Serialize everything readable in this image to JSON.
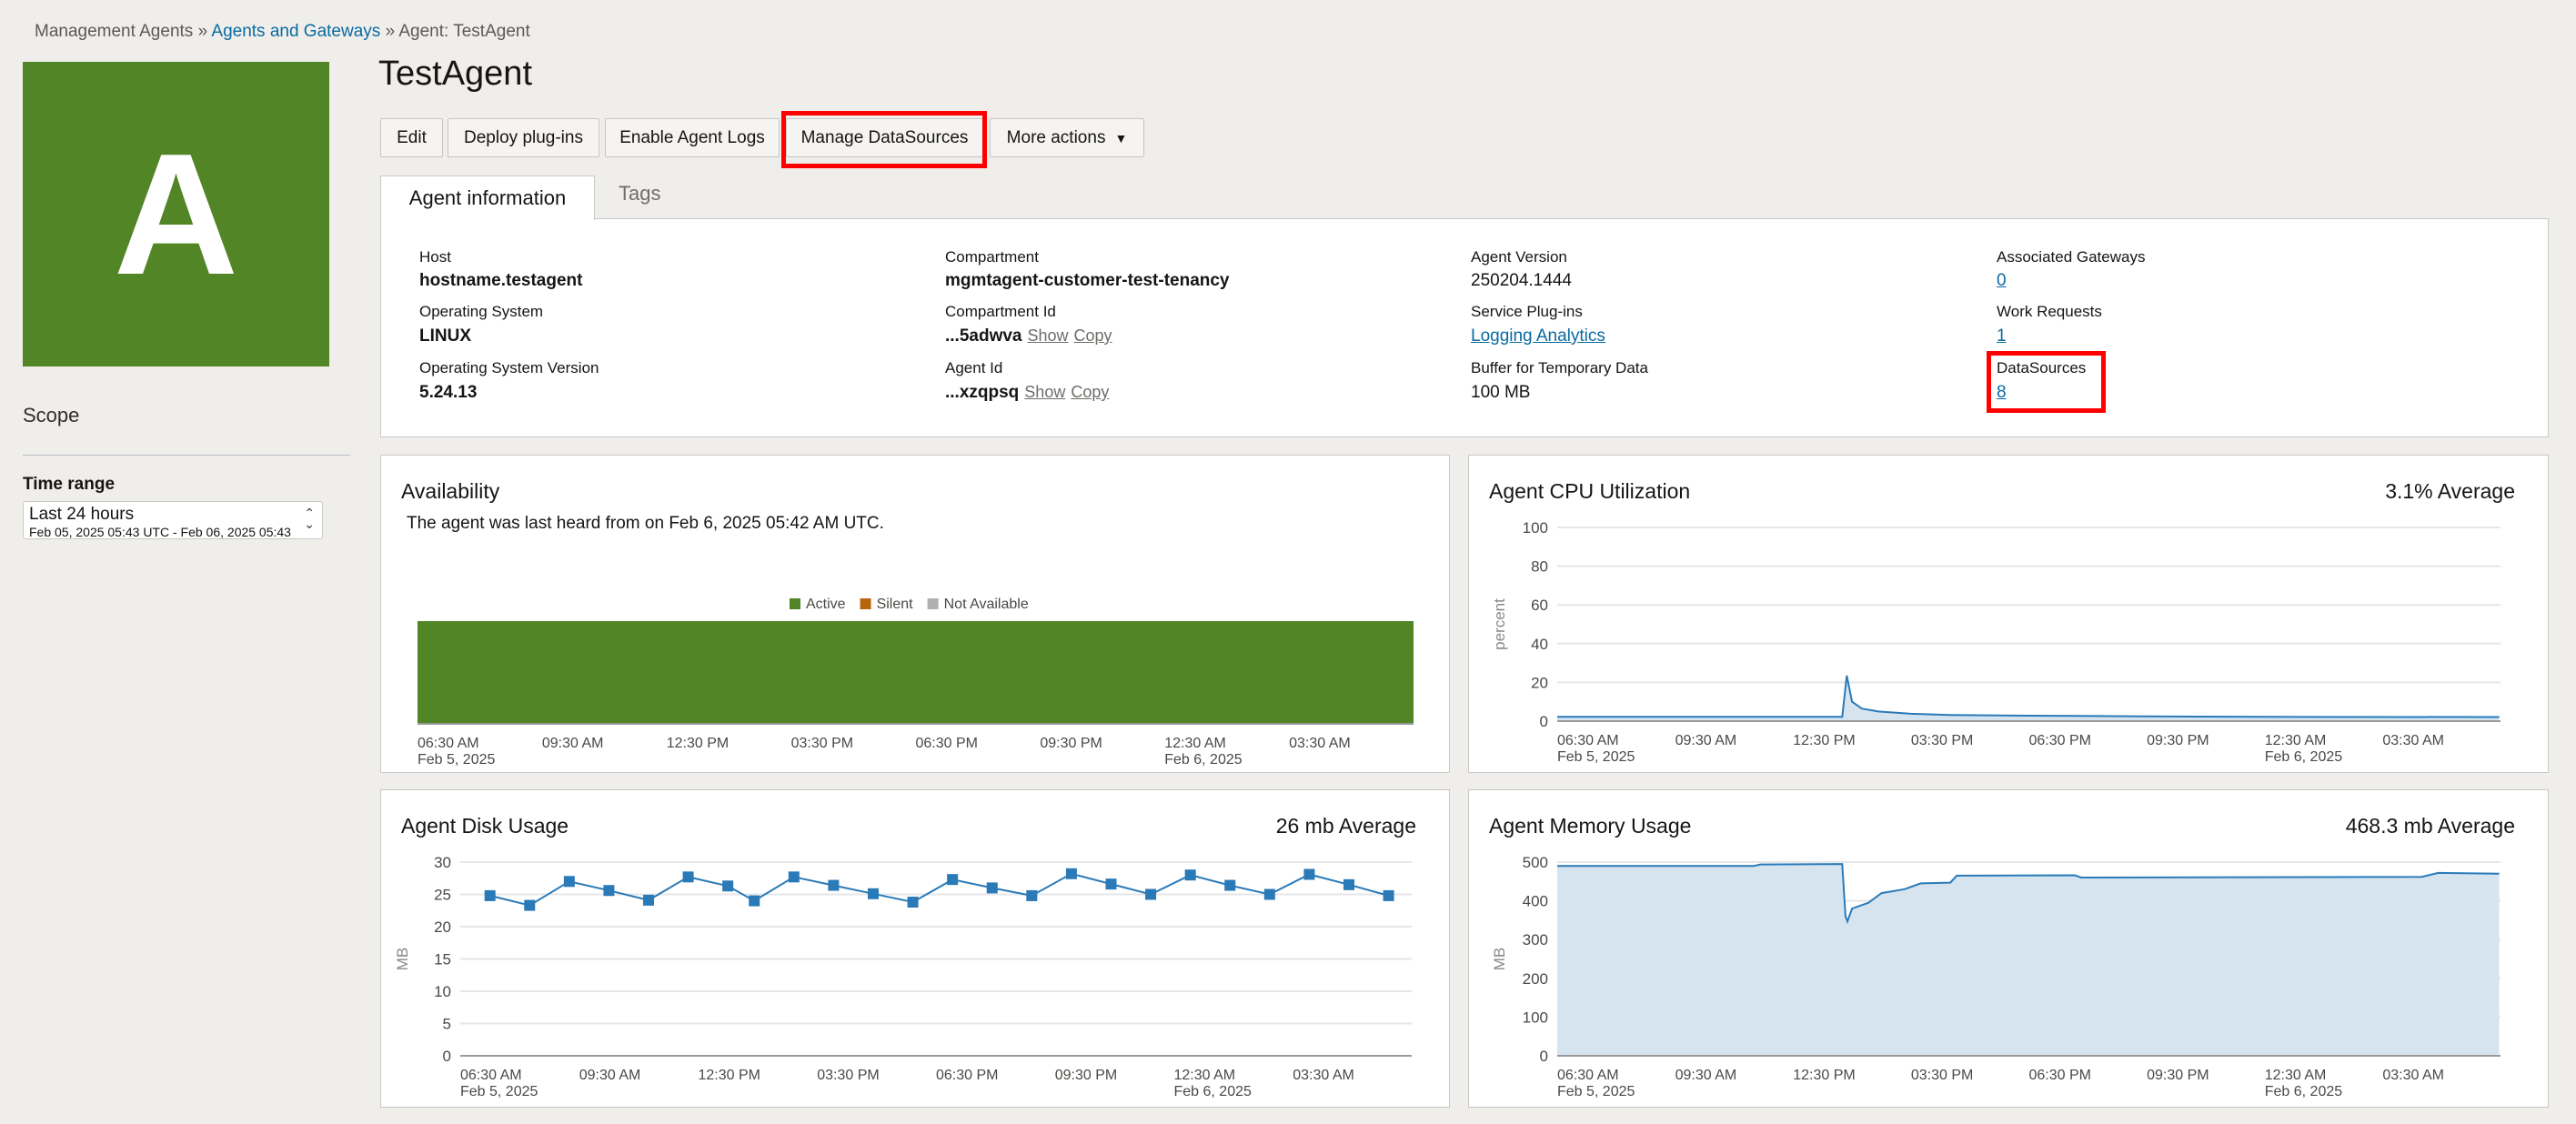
{
  "breadcrumb": {
    "items": [
      "Management Agents",
      "Agents and Gateways",
      "Agent: TestAgent"
    ],
    "separator": "»"
  },
  "avatar": {
    "letter": "A",
    "color": "#528526"
  },
  "sidebar": {
    "scope_label": "Scope",
    "time_range": {
      "label": "Time range",
      "value": "Last 24 hours",
      "detail": "Feb 05, 2025 05:43 UTC - Feb 06, 2025 05:43"
    }
  },
  "header": {
    "title": "TestAgent"
  },
  "toolbar": {
    "edit": "Edit",
    "deploy_plugins": "Deploy plug-ins",
    "enable_logs": "Enable Agent Logs",
    "manage_datasources": "Manage DataSources",
    "more_actions": "More actions",
    "more_actions_caret": "▼"
  },
  "tabs": [
    {
      "label": "Agent information",
      "active": true
    },
    {
      "label": "Tags",
      "active": false
    }
  ],
  "info": {
    "host": {
      "label": "Host",
      "value": "hostname.testagent"
    },
    "os": {
      "label": "Operating System",
      "value": "LINUX"
    },
    "os_version": {
      "label": "Operating System Version",
      "value": "5.24.13"
    },
    "compartment": {
      "label": "Compartment",
      "value": "mgmtagent-customer-test-tenancy"
    },
    "compartment_id": {
      "label": "Compartment Id",
      "value": "...5adwva",
      "show": "Show",
      "copy": "Copy"
    },
    "agent_id": {
      "label": "Agent Id",
      "value": "...xzqpsq",
      "show": "Show",
      "copy": "Copy"
    },
    "agent_version": {
      "label": "Agent Version",
      "value": "250204.1444"
    },
    "service_plugins": {
      "label": "Service Plug-ins",
      "value": "Logging Analytics"
    },
    "buffer": {
      "label": "Buffer for Temporary Data",
      "value": "100 MB"
    },
    "associated_gateways": {
      "label": "Associated Gateways",
      "value": "0"
    },
    "work_requests": {
      "label": "Work Requests",
      "value": "1"
    },
    "datasources": {
      "label": "DataSources",
      "value": "8"
    }
  },
  "highlight_color": "#ff0000",
  "panels": {
    "availability": {
      "title": "Availability",
      "message": "The agent was last heard from on Feb 6, 2025 05:42 AM UTC."
    },
    "cpu": {
      "title": "Agent CPU Utilization",
      "average": "3.1% Average"
    },
    "disk": {
      "title": "Agent Disk Usage",
      "average": "26 mb Average"
    },
    "memory": {
      "title": "Agent Memory Usage",
      "average": "468.3 mb Average"
    }
  },
  "chart_data": [
    {
      "id": "availability",
      "type": "bar",
      "legend": [
        {
          "name": "Active",
          "color": "#528526"
        },
        {
          "name": "Silent",
          "color": "#b8640c"
        },
        {
          "name": "Not Available",
          "color": "#b0b0b0"
        }
      ],
      "legend_position": "top",
      "segments": [
        {
          "status": "Active",
          "start": "2025-02-05T06:30",
          "end": "2025-02-06T06:30"
        }
      ],
      "xlim": [
        "2025-02-05T06:30",
        "2025-02-06T06:30"
      ],
      "x_ticks": [
        {
          "time": "2025-02-05T06:30",
          "label": "06:30 AM",
          "sublabel": "Feb 5, 2025"
        },
        {
          "time": "2025-02-05T09:30",
          "label": "09:30 AM",
          "sublabel": ""
        },
        {
          "time": "2025-02-05T12:30",
          "label": "12:30 PM",
          "sublabel": ""
        },
        {
          "time": "2025-02-05T15:30",
          "label": "03:30 PM",
          "sublabel": ""
        },
        {
          "time": "2025-02-05T18:30",
          "label": "06:30 PM",
          "sublabel": ""
        },
        {
          "time": "2025-02-05T21:30",
          "label": "09:30 PM",
          "sublabel": ""
        },
        {
          "time": "2025-02-06T00:30",
          "label": "12:30 AM",
          "sublabel": "Feb 6, 2025"
        },
        {
          "time": "2025-02-06T03:30",
          "label": "03:30 AM",
          "sublabel": ""
        }
      ]
    },
    {
      "id": "cpu",
      "type": "area",
      "ylabel": "percent",
      "ylim": [
        0,
        100
      ],
      "y_ticks": [
        0,
        20,
        40,
        60,
        80,
        100
      ],
      "grid": true,
      "color": "#2a7ab8",
      "xlim": [
        "2025-02-05T06:30",
        "2025-02-06T06:30"
      ],
      "x_ticks": [
        {
          "time": "2025-02-05T06:30",
          "label": "06:30 AM",
          "sublabel": "Feb 5, 2025"
        },
        {
          "time": "2025-02-05T09:30",
          "label": "09:30 AM",
          "sublabel": ""
        },
        {
          "time": "2025-02-05T12:30",
          "label": "12:30 PM",
          "sublabel": ""
        },
        {
          "time": "2025-02-05T15:30",
          "label": "03:30 PM",
          "sublabel": ""
        },
        {
          "time": "2025-02-05T18:30",
          "label": "06:30 PM",
          "sublabel": ""
        },
        {
          "time": "2025-02-05T21:30",
          "label": "09:30 PM",
          "sublabel": ""
        },
        {
          "time": "2025-02-06T00:30",
          "label": "12:30 AM",
          "sublabel": "Feb 6, 2025"
        },
        {
          "time": "2025-02-06T03:30",
          "label": "03:30 AM",
          "sublabel": ""
        }
      ],
      "points": [
        [
          "2025-02-05T06:30",
          2.2
        ],
        [
          "2025-02-05T13:45",
          2.2
        ],
        [
          "2025-02-05T13:52",
          23.5
        ],
        [
          "2025-02-05T14:00",
          10
        ],
        [
          "2025-02-05T14:15",
          6.5
        ],
        [
          "2025-02-05T14:40",
          5
        ],
        [
          "2025-02-05T15:30",
          3.8
        ],
        [
          "2025-02-05T16:30",
          3.2
        ],
        [
          "2025-02-05T18:30",
          2.8
        ],
        [
          "2025-02-05T21:30",
          2.5
        ],
        [
          "2025-02-06T00:30",
          2.2
        ],
        [
          "2025-02-06T06:28",
          2.1
        ]
      ]
    },
    {
      "id": "disk",
      "type": "line",
      "ylabel": "MB",
      "ylim": [
        0,
        30
      ],
      "y_ticks": [
        0,
        5,
        10,
        15,
        20,
        25,
        30
      ],
      "grid": true,
      "color": "#2a7ab8",
      "marker": "square",
      "xlim": [
        "2025-02-05T06:30",
        "2025-02-06T06:30"
      ],
      "x_ticks": [
        {
          "time": "2025-02-05T06:30",
          "label": "06:30 AM",
          "sublabel": "Feb 5, 2025"
        },
        {
          "time": "2025-02-05T09:30",
          "label": "09:30 AM",
          "sublabel": ""
        },
        {
          "time": "2025-02-05T12:30",
          "label": "12:30 PM",
          "sublabel": ""
        },
        {
          "time": "2025-02-05T15:30",
          "label": "03:30 PM",
          "sublabel": ""
        },
        {
          "time": "2025-02-05T18:30",
          "label": "06:30 PM",
          "sublabel": ""
        },
        {
          "time": "2025-02-05T21:30",
          "label": "09:30 PM",
          "sublabel": ""
        },
        {
          "time": "2025-02-06T00:30",
          "label": "12:30 AM",
          "sublabel": "Feb 6, 2025"
        },
        {
          "time": "2025-02-06T03:30",
          "label": "03:30 AM",
          "sublabel": ""
        }
      ],
      "points": [
        [
          "2025-02-05T07:15",
          24.8
        ],
        [
          "2025-02-05T08:15",
          23.3
        ],
        [
          "2025-02-05T09:15",
          27.0
        ],
        [
          "2025-02-05T10:15",
          25.6
        ],
        [
          "2025-02-05T11:15",
          24.1
        ],
        [
          "2025-02-05T12:15",
          27.7
        ],
        [
          "2025-02-05T13:15",
          26.3
        ],
        [
          "2025-02-05T13:55",
          24.0
        ],
        [
          "2025-02-05T14:55",
          27.7
        ],
        [
          "2025-02-05T15:55",
          26.4
        ],
        [
          "2025-02-05T16:55",
          25.1
        ],
        [
          "2025-02-05T17:55",
          23.8
        ],
        [
          "2025-02-05T18:55",
          27.3
        ],
        [
          "2025-02-05T19:55",
          26.0
        ],
        [
          "2025-02-05T20:55",
          24.8
        ],
        [
          "2025-02-05T21:55",
          28.2
        ],
        [
          "2025-02-05T22:55",
          26.6
        ],
        [
          "2025-02-05T23:55",
          25.0
        ],
        [
          "2025-02-06T00:55",
          28.0
        ],
        [
          "2025-02-06T01:55",
          26.4
        ],
        [
          "2025-02-06T02:55",
          25.0
        ],
        [
          "2025-02-06T03:55",
          28.1
        ],
        [
          "2025-02-06T04:55",
          26.5
        ],
        [
          "2025-02-06T05:55",
          24.8
        ]
      ]
    },
    {
      "id": "memory",
      "type": "area",
      "ylabel": "MB",
      "ylim": [
        0,
        500
      ],
      "y_ticks": [
        0,
        100,
        200,
        300,
        400,
        500
      ],
      "grid": true,
      "color": "#2a7ab8",
      "xlim": [
        "2025-02-05T06:30",
        "2025-02-06T06:30"
      ],
      "x_ticks": [
        {
          "time": "2025-02-05T06:30",
          "label": "06:30 AM",
          "sublabel": "Feb 5, 2025"
        },
        {
          "time": "2025-02-05T09:30",
          "label": "09:30 AM",
          "sublabel": ""
        },
        {
          "time": "2025-02-05T12:30",
          "label": "12:30 PM",
          "sublabel": ""
        },
        {
          "time": "2025-02-05T15:30",
          "label": "03:30 PM",
          "sublabel": ""
        },
        {
          "time": "2025-02-05T18:30",
          "label": "06:30 PM",
          "sublabel": ""
        },
        {
          "time": "2025-02-05T21:30",
          "label": "09:30 PM",
          "sublabel": ""
        },
        {
          "time": "2025-02-06T00:30",
          "label": "12:30 AM",
          "sublabel": "Feb 6, 2025"
        },
        {
          "time": "2025-02-06T03:30",
          "label": "03:30 AM",
          "sublabel": ""
        }
      ],
      "points": [
        [
          "2025-02-05T06:30",
          490
        ],
        [
          "2025-02-05T11:30",
          490
        ],
        [
          "2025-02-05T11:40",
          494
        ],
        [
          "2025-02-05T13:45",
          495
        ],
        [
          "2025-02-05T13:50",
          360
        ],
        [
          "2025-02-05T13:53",
          347
        ],
        [
          "2025-02-05T14:00",
          380
        ],
        [
          "2025-02-05T14:25",
          395
        ],
        [
          "2025-02-05T14:45",
          420
        ],
        [
          "2025-02-05T15:20",
          430
        ],
        [
          "2025-02-05T15:45",
          445
        ],
        [
          "2025-02-05T16:30",
          447
        ],
        [
          "2025-02-05T16:40",
          465
        ],
        [
          "2025-02-05T19:40",
          466
        ],
        [
          "2025-02-05T19:50",
          460
        ],
        [
          "2025-02-06T04:30",
          462
        ],
        [
          "2025-02-06T04:55",
          472
        ],
        [
          "2025-02-06T06:28",
          470
        ]
      ]
    }
  ]
}
